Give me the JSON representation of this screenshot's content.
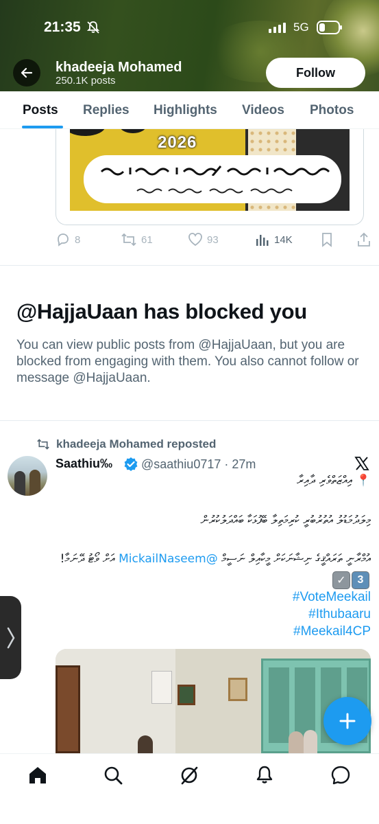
{
  "status_bar": {
    "time": "21:35",
    "network": "5G"
  },
  "header": {
    "profile_name": "khadeeja Mohamed",
    "posts_count": "250.1K posts",
    "follow_label": "Follow"
  },
  "tabs": [
    {
      "label": "Posts",
      "active": true
    },
    {
      "label": "Replies",
      "active": false
    },
    {
      "label": "Highlights",
      "active": false
    },
    {
      "label": "Videos",
      "active": false
    },
    {
      "label": "Photos",
      "active": false
    }
  ],
  "first_post": {
    "banner_year": "2026",
    "actions": {
      "replies": "8",
      "reposts": "61",
      "likes": "93",
      "views": "14K"
    }
  },
  "blocked_notice": {
    "title": "@HajjaUaan has blocked you",
    "text": "You can view public posts from @HajjaUaan, but you are blocked from engaging with them. You also cannot follow or message @HajjaUaan."
  },
  "repost": {
    "reposted_by": "khadeeja Mohamed reposted",
    "author_name": "Saathiu‰",
    "author_handle": "@saathiu0717 · 27m",
    "line1": "📍 އިއްޒަތްވެރި ދާއިރާ",
    "line2": "މިލަދުމަޑުލު އުތުރުބުރީ ކުރިމަތިލާ ބޭފުޅަކާ ބައްދަލުކުރުން",
    "line3_text": "އުމްރާނީ ތަރައްޤީގެ ނިޝާނަކަށް މީކާއިލް ނަސީމް ",
    "line3_tail": " އަށް ވޯޓު ދޭނަމާ!",
    "mention": "@MickailNaseem",
    "emoji_check": "✓",
    "emoji_number": "3",
    "hashtags": [
      "#VoteMeekail",
      "#Ithubaaru",
      "#Meekail4CP"
    ]
  },
  "colors": {
    "accent": "#1d9bf0",
    "text": "#0f1419",
    "muted": "#536471"
  }
}
